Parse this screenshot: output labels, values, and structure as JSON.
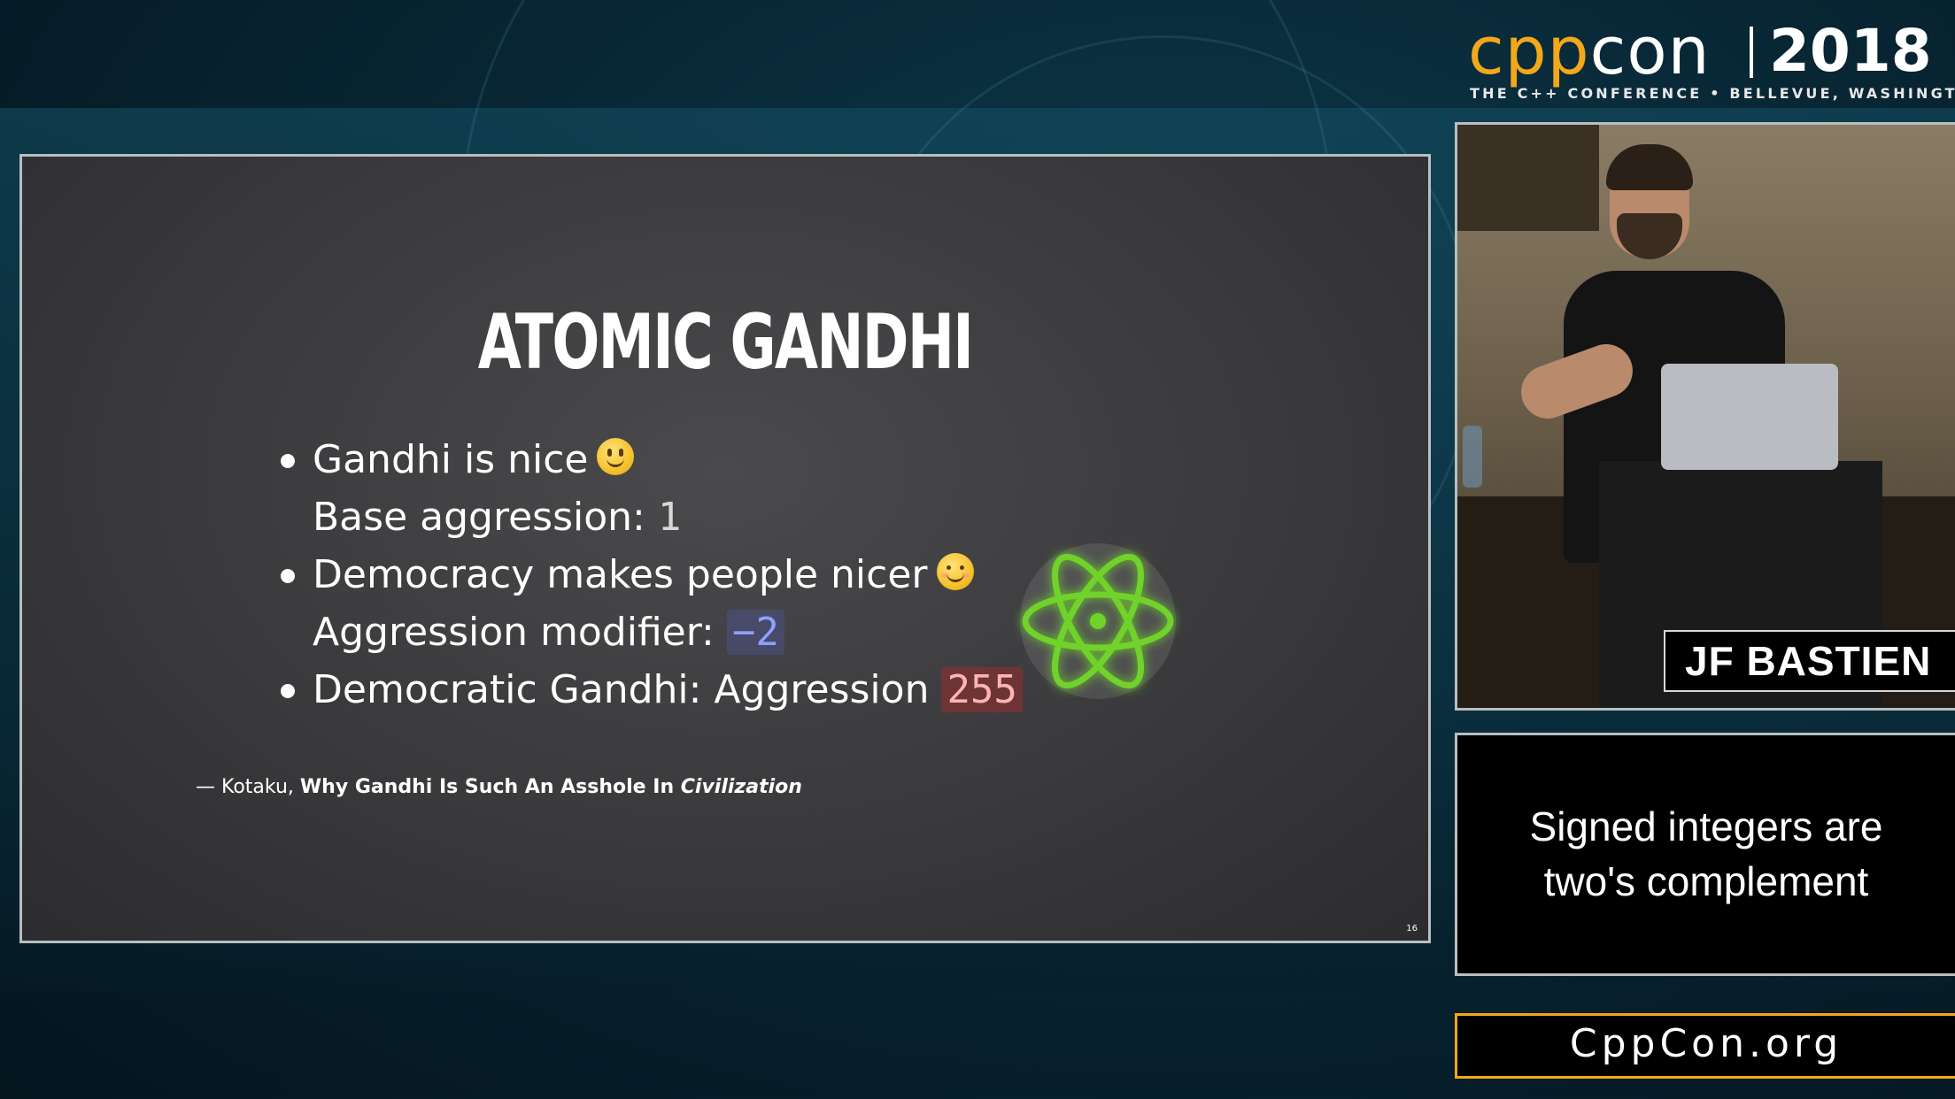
{
  "header": {
    "logo_cpp": "cpp",
    "logo_con": "con",
    "logo_year": "2018",
    "tagline": "THE C++ CONFERENCE • BELLEVUE, WASHINGTON",
    "brand_color": "#f3a81b"
  },
  "slide": {
    "title": "ATOMIC GANDHI",
    "bullets": [
      {
        "text": "Gandhi is nice",
        "icon": "slightly-smiling-face-emoji",
        "sub_label": "Base aggression: ",
        "sub_value": "1"
      },
      {
        "text": "Democracy makes people nicer",
        "icon": "smiling-face-with-smiling-eyes-emoji",
        "sub_label": "Aggression modifier: ",
        "sub_value": "−2"
      },
      {
        "text": "Democratic Gandhi: Aggression ",
        "value": "255"
      }
    ],
    "citation": {
      "prefix": "— Kotaku, ",
      "title": "Why Gandhi Is Such An Asshole In ",
      "title_italic": "Civilization"
    },
    "slide_number": "16",
    "atom_icon": "atom-icon",
    "atom_color": "#6fd22b"
  },
  "speaker": {
    "name": "JF BASTIEN"
  },
  "topic": {
    "line1": "Signed integers are",
    "line2": "two's complement"
  },
  "footer": {
    "url": "CppCon.org"
  }
}
